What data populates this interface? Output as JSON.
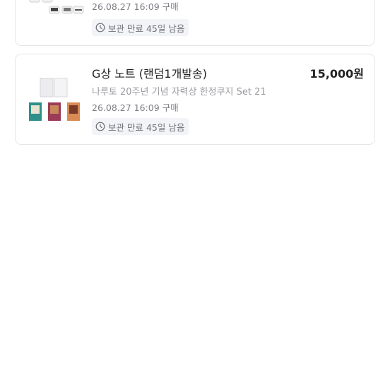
{
  "orders": [
    {
      "purchase_date": "26.08.27 16:09 구매",
      "storage_badge": "보관 만료 45일 남음",
      "badge_icon": "clock-icon"
    },
    {
      "title": "G상 노트 (랜덤1개발송)",
      "price": "15,000원",
      "subtitle": "나루토 20주년 기념 자력상 한정쿠지 Set 21",
      "purchase_date": "26.08.27 16:09 구매",
      "storage_badge": "보관 만료 45일 남음",
      "badge_icon": "clock-icon"
    }
  ],
  "colors": {
    "card_border": "#e6e6e9",
    "badge_bg": "#f3f4f7",
    "title": "#222222",
    "muted": "#9a9aa0"
  }
}
